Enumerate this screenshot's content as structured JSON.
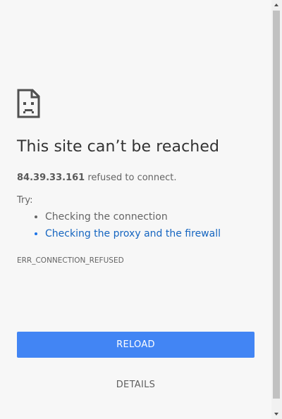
{
  "error": {
    "icon": "sad-page-icon",
    "title": "This site can’t be reached",
    "host": "84.39.33.161",
    "summary_suffix": " refused to connect.",
    "try_label": "Try:",
    "suggestions": [
      "Checking the connection",
      "Checking the proxy and the firewall"
    ],
    "code": "ERR_CONNECTION_REFUSED"
  },
  "buttons": {
    "reload_label": "Reload",
    "details_label": "Details"
  },
  "colors": {
    "background": "#f7f7f7",
    "accent": "#4285f4",
    "link": "#1565c0"
  }
}
